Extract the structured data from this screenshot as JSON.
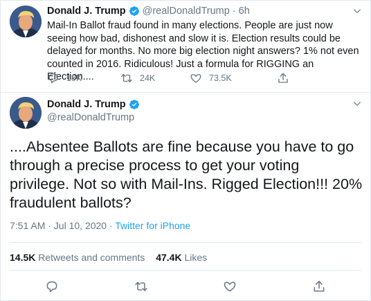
{
  "tweet1": {
    "name": "Donald J. Trump",
    "handle": "@realDonaldTrump",
    "separator": "·",
    "time": "6h",
    "text": "Mail-In Ballot fraud found in many elections. People are just now seeing how bad, dishonest and slow it is. Election results could be delayed for months. No more big election night answers? 1% not even counted in 2016. Ridiculous! Just a formula for RIGGING an Election....",
    "replies": "18K",
    "retweets": "24K",
    "likes": "73.5K"
  },
  "tweet2": {
    "name": "Donald J. Trump",
    "handle": "@realDonaldTrump",
    "text": "....Absentee Ballots are fine because you have to go through a precise process to get your voting privilege. Not so with Mail-Ins. Rigged Election!!! 20% fraudulent ballots?",
    "timestamp": "7:51 AM · Jul 10, 2020 ·",
    "source": "Twitter for iPhone",
    "retweets_count": "14.5K",
    "retweets_label": "Retweets and comments",
    "likes_count": "47.4K",
    "likes_label": "Likes"
  },
  "colors": {
    "text": "#14171a",
    "secondary": "#657786",
    "accent": "#1da1f2",
    "border": "#e1e8ed"
  },
  "icons": [
    "verified-badge-icon",
    "chevron-down-icon",
    "reply-icon",
    "retweet-icon",
    "like-icon",
    "share-icon"
  ]
}
